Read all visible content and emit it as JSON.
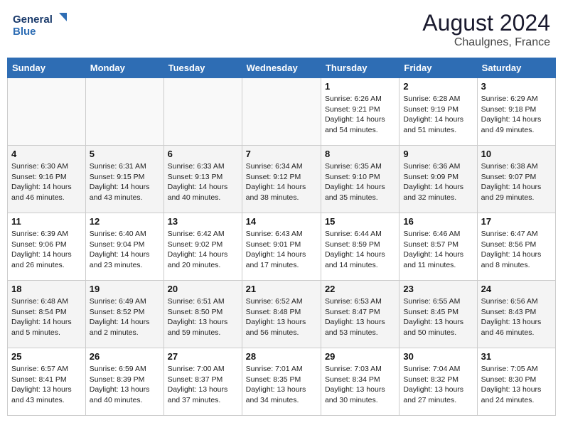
{
  "header": {
    "logo_line1": "General",
    "logo_line2": "Blue",
    "main_title": "August 2024",
    "subtitle": "Chaulgnes, France"
  },
  "weekdays": [
    "Sunday",
    "Monday",
    "Tuesday",
    "Wednesday",
    "Thursday",
    "Friday",
    "Saturday"
  ],
  "weeks": [
    [
      {
        "day": "",
        "sunrise": "",
        "sunset": "",
        "daylight": ""
      },
      {
        "day": "",
        "sunrise": "",
        "sunset": "",
        "daylight": ""
      },
      {
        "day": "",
        "sunrise": "",
        "sunset": "",
        "daylight": ""
      },
      {
        "day": "",
        "sunrise": "",
        "sunset": "",
        "daylight": ""
      },
      {
        "day": "1",
        "sunrise": "Sunrise: 6:26 AM",
        "sunset": "Sunset: 9:21 PM",
        "daylight": "Daylight: 14 hours and 54 minutes."
      },
      {
        "day": "2",
        "sunrise": "Sunrise: 6:28 AM",
        "sunset": "Sunset: 9:19 PM",
        "daylight": "Daylight: 14 hours and 51 minutes."
      },
      {
        "day": "3",
        "sunrise": "Sunrise: 6:29 AM",
        "sunset": "Sunset: 9:18 PM",
        "daylight": "Daylight: 14 hours and 49 minutes."
      }
    ],
    [
      {
        "day": "4",
        "sunrise": "Sunrise: 6:30 AM",
        "sunset": "Sunset: 9:16 PM",
        "daylight": "Daylight: 14 hours and 46 minutes."
      },
      {
        "day": "5",
        "sunrise": "Sunrise: 6:31 AM",
        "sunset": "Sunset: 9:15 PM",
        "daylight": "Daylight: 14 hours and 43 minutes."
      },
      {
        "day": "6",
        "sunrise": "Sunrise: 6:33 AM",
        "sunset": "Sunset: 9:13 PM",
        "daylight": "Daylight: 14 hours and 40 minutes."
      },
      {
        "day": "7",
        "sunrise": "Sunrise: 6:34 AM",
        "sunset": "Sunset: 9:12 PM",
        "daylight": "Daylight: 14 hours and 38 minutes."
      },
      {
        "day": "8",
        "sunrise": "Sunrise: 6:35 AM",
        "sunset": "Sunset: 9:10 PM",
        "daylight": "Daylight: 14 hours and 35 minutes."
      },
      {
        "day": "9",
        "sunrise": "Sunrise: 6:36 AM",
        "sunset": "Sunset: 9:09 PM",
        "daylight": "Daylight: 14 hours and 32 minutes."
      },
      {
        "day": "10",
        "sunrise": "Sunrise: 6:38 AM",
        "sunset": "Sunset: 9:07 PM",
        "daylight": "Daylight: 14 hours and 29 minutes."
      }
    ],
    [
      {
        "day": "11",
        "sunrise": "Sunrise: 6:39 AM",
        "sunset": "Sunset: 9:06 PM",
        "daylight": "Daylight: 14 hours and 26 minutes."
      },
      {
        "day": "12",
        "sunrise": "Sunrise: 6:40 AM",
        "sunset": "Sunset: 9:04 PM",
        "daylight": "Daylight: 14 hours and 23 minutes."
      },
      {
        "day": "13",
        "sunrise": "Sunrise: 6:42 AM",
        "sunset": "Sunset: 9:02 PM",
        "daylight": "Daylight: 14 hours and 20 minutes."
      },
      {
        "day": "14",
        "sunrise": "Sunrise: 6:43 AM",
        "sunset": "Sunset: 9:01 PM",
        "daylight": "Daylight: 14 hours and 17 minutes."
      },
      {
        "day": "15",
        "sunrise": "Sunrise: 6:44 AM",
        "sunset": "Sunset: 8:59 PM",
        "daylight": "Daylight: 14 hours and 14 minutes."
      },
      {
        "day": "16",
        "sunrise": "Sunrise: 6:46 AM",
        "sunset": "Sunset: 8:57 PM",
        "daylight": "Daylight: 14 hours and 11 minutes."
      },
      {
        "day": "17",
        "sunrise": "Sunrise: 6:47 AM",
        "sunset": "Sunset: 8:56 PM",
        "daylight": "Daylight: 14 hours and 8 minutes."
      }
    ],
    [
      {
        "day": "18",
        "sunrise": "Sunrise: 6:48 AM",
        "sunset": "Sunset: 8:54 PM",
        "daylight": "Daylight: 14 hours and 5 minutes."
      },
      {
        "day": "19",
        "sunrise": "Sunrise: 6:49 AM",
        "sunset": "Sunset: 8:52 PM",
        "daylight": "Daylight: 14 hours and 2 minutes."
      },
      {
        "day": "20",
        "sunrise": "Sunrise: 6:51 AM",
        "sunset": "Sunset: 8:50 PM",
        "daylight": "Daylight: 13 hours and 59 minutes."
      },
      {
        "day": "21",
        "sunrise": "Sunrise: 6:52 AM",
        "sunset": "Sunset: 8:48 PM",
        "daylight": "Daylight: 13 hours and 56 minutes."
      },
      {
        "day": "22",
        "sunrise": "Sunrise: 6:53 AM",
        "sunset": "Sunset: 8:47 PM",
        "daylight": "Daylight: 13 hours and 53 minutes."
      },
      {
        "day": "23",
        "sunrise": "Sunrise: 6:55 AM",
        "sunset": "Sunset: 8:45 PM",
        "daylight": "Daylight: 13 hours and 50 minutes."
      },
      {
        "day": "24",
        "sunrise": "Sunrise: 6:56 AM",
        "sunset": "Sunset: 8:43 PM",
        "daylight": "Daylight: 13 hours and 46 minutes."
      }
    ],
    [
      {
        "day": "25",
        "sunrise": "Sunrise: 6:57 AM",
        "sunset": "Sunset: 8:41 PM",
        "daylight": "Daylight: 13 hours and 43 minutes."
      },
      {
        "day": "26",
        "sunrise": "Sunrise: 6:59 AM",
        "sunset": "Sunset: 8:39 PM",
        "daylight": "Daylight: 13 hours and 40 minutes."
      },
      {
        "day": "27",
        "sunrise": "Sunrise: 7:00 AM",
        "sunset": "Sunset: 8:37 PM",
        "daylight": "Daylight: 13 hours and 37 minutes."
      },
      {
        "day": "28",
        "sunrise": "Sunrise: 7:01 AM",
        "sunset": "Sunset: 8:35 PM",
        "daylight": "Daylight: 13 hours and 34 minutes."
      },
      {
        "day": "29",
        "sunrise": "Sunrise: 7:03 AM",
        "sunset": "Sunset: 8:34 PM",
        "daylight": "Daylight: 13 hours and 30 minutes."
      },
      {
        "day": "30",
        "sunrise": "Sunrise: 7:04 AM",
        "sunset": "Sunset: 8:32 PM",
        "daylight": "Daylight: 13 hours and 27 minutes."
      },
      {
        "day": "31",
        "sunrise": "Sunrise: 7:05 AM",
        "sunset": "Sunset: 8:30 PM",
        "daylight": "Daylight: 13 hours and 24 minutes."
      }
    ]
  ]
}
